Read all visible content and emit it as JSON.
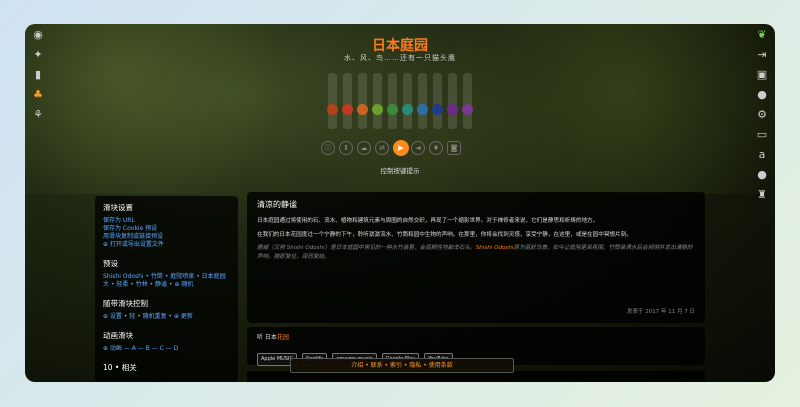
{
  "app": {
    "title": "日本庭园",
    "subtitle": "水、风、鸟……还有一只猫头鹰"
  },
  "left_rail": [
    {
      "name": "soundcloud-icon",
      "glyph": "◉"
    },
    {
      "name": "twitter-icon",
      "glyph": "✦"
    },
    {
      "name": "library-icon",
      "glyph": "▮"
    },
    {
      "name": "cat-icon",
      "glyph": "♣"
    },
    {
      "name": "leaf-icon",
      "glyph": "⚘"
    }
  ],
  "right_rail": [
    {
      "name": "app-icon",
      "glyph": "❦"
    },
    {
      "name": "login-icon",
      "glyph": "⇥"
    },
    {
      "name": "gift-icon",
      "glyph": "▣"
    },
    {
      "name": "piggy-bank-icon",
      "glyph": "●"
    },
    {
      "name": "help-icon",
      "glyph": "⚙"
    },
    {
      "name": "tv-icon",
      "glyph": "▭"
    },
    {
      "name": "amazon-icon",
      "glyph": "a"
    },
    {
      "name": "apple-icon",
      "glyph": "●"
    },
    {
      "name": "android-icon",
      "glyph": "♜"
    }
  ],
  "sliders": [
    {
      "color": "#b0421d",
      "level": 0.7
    },
    {
      "color": "#c23a24",
      "level": 0.7
    },
    {
      "color": "#c86421",
      "level": 0.7
    },
    {
      "color": "#6e9d2a",
      "level": 0.7
    },
    {
      "color": "#3c8a38",
      "level": 0.7
    },
    {
      "color": "#2a8a77",
      "level": 0.7
    },
    {
      "color": "#2a6fa0",
      "level": 0.7
    },
    {
      "color": "#1e3b8a",
      "level": 0.7
    },
    {
      "color": "#6a2a8a",
      "level": 0.7
    },
    {
      "color": "#7a3a90",
      "level": 0.7
    }
  ],
  "controls": [
    {
      "name": "info-button",
      "glyph": "ⓘ"
    },
    {
      "name": "pause-button",
      "glyph": "Ⅱ"
    },
    {
      "name": "cloud-button",
      "glyph": "☁"
    },
    {
      "name": "shuffle-button",
      "glyph": "⇄"
    },
    {
      "name": "play-button",
      "glyph": "▶"
    },
    {
      "name": "volume-button",
      "glyph": "◄"
    },
    {
      "name": "drop-button",
      "glyph": "♦"
    },
    {
      "name": "camera-button",
      "glyph": "◙"
    }
  ],
  "controls_label": "控制按键提示",
  "sidebar": {
    "sec1_title": "滑块设置",
    "sec1_links": [
      "保存为 URL",
      "保存为 Cookie 预设",
      "用滑块复制或链接预设",
      "⊕ 打开或导出设置文件"
    ],
    "sec2_title": "预设",
    "sec2_text_a": "Shishi Odoshi • 竹筒 • 庭院喷泉 • 日本庭园",
    "sec2_text_b": "大 • 轻柔 • 竹林 • 静谧 • ⊕ 随机",
    "sec3_title": "随带滑块控制",
    "sec3_text": "⊕ 设置 • 轻 • 随机重复 • ⊕ 更新",
    "sec4_title": "动画滑块",
    "sec4_text": "⊕ 动画 — A — B — C — D",
    "sec5_title": "10 • 相关"
  },
  "main": {
    "title": "清凉的静谧",
    "p1": "日本庭园通过将使用的石、流水、植物和建筑元素与周围的自然交织，再现了一个缩影世界。对于禅修者来说，它们是静思和祈祷的地方。",
    "p2": "在我们的日本花园度过一个宁静的下午，聆听潺潺流水、竹筒和园中生物的声响。在那里，你将会找到灵感，享受宁静，在这里，或是在园中冥想片刻。",
    "p3a": "鹿威（又称 Shishi Odoshi）是日本庭园中常见的一种水竹装置，会周期性地敲击石头。",
    "p3_hl": "Shishi Odoshi",
    "p3b": "原为驱赶鸟兽，如今让庭院更具氛围。竹筒装满水后会倾倒并发出清脆的声响，随即复位，周而复始。",
    "date": "发表于 2017 年 11 月 7 日"
  },
  "listen": {
    "label_prefix": "听 日本",
    "label_hl": "花园",
    "badges": [
      "Apple MUSIC",
      "Spotify",
      "amazon music",
      "Google Play",
      "YouTube"
    ]
  },
  "footer": {
    "text": "介绍 • 联系 • 索引 • 隐私 • 使用条款"
  }
}
